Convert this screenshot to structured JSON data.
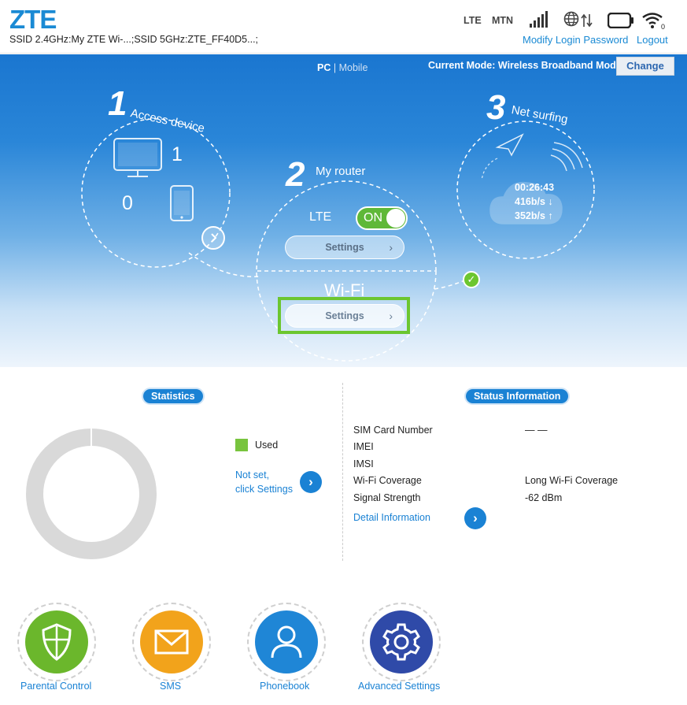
{
  "header": {
    "logo": "ZTE",
    "ssid_text": "SSID 2.4GHz:My ZTE Wi-...;SSID 5GHz:ZTE_FF40D5...;",
    "network_type": "LTE",
    "operator": "MTN",
    "modify_password": "Modify Login Password",
    "logout": "Logout"
  },
  "hero": {
    "view_pc": "PC",
    "view_sep": "|",
    "view_mobile": "Mobile",
    "mode_text": "Current Mode: Wireless Broadband Mode",
    "change": "Change",
    "step1_num": "1",
    "step1_title": "Access device",
    "wired_count": "1",
    "wireless_count": "0",
    "step2_num": "2",
    "step2_title": "My router",
    "lte_label": "LTE",
    "toggle_label": "ON",
    "settings_label": "Settings",
    "wifi_label": "Wi-Fi",
    "wifi_settings_label": "Settings",
    "step3_num": "3",
    "step3_title": "Net surfing",
    "duration": "00:26:43",
    "download": "416b/s ↓",
    "upload": "352b/s ↑"
  },
  "stats": {
    "title": "Statistics",
    "legend_used": "Used",
    "notset_line1": "Not set,",
    "notset_line2": "click Settings"
  },
  "status": {
    "title": "Status Information",
    "rows": [
      {
        "label": "SIM Card Number",
        "value": "— —"
      },
      {
        "label": "IMEI",
        "value": ""
      },
      {
        "label": "IMSI",
        "value": ""
      },
      {
        "label": "Wi-Fi Coverage",
        "value": "Long Wi-Fi Coverage"
      },
      {
        "label": "Signal Strength",
        "value": "-62 dBm"
      }
    ],
    "detail_link": "Detail Information"
  },
  "apps": {
    "parental": "Parental Control",
    "sms": "SMS",
    "phonebook": "Phonebook",
    "advanced": "Advanced Settings"
  },
  "colors": {
    "brand_blue": "#1a8ad4",
    "green": "#6cc62f",
    "sms_orange": "#f2a31b",
    "advanced_navy": "#2f4aa8"
  }
}
